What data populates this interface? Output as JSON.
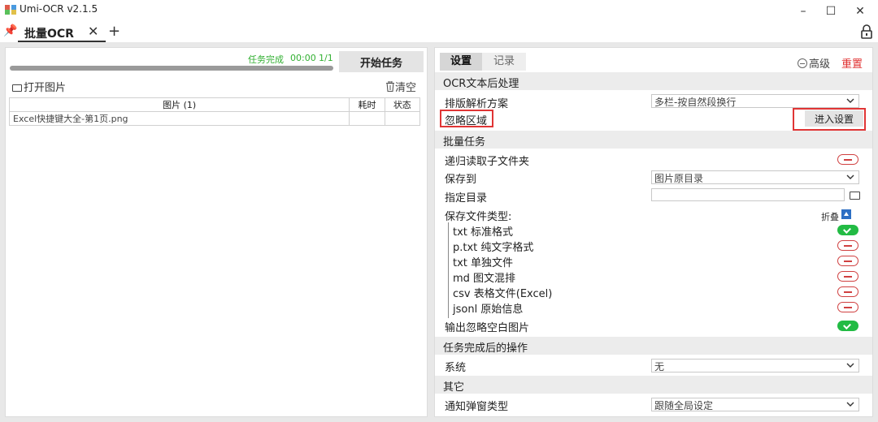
{
  "window": {
    "title": "Umi-OCR v2.1.5",
    "minimize": "–",
    "maximize": "☐",
    "close": "✕"
  },
  "tabbar": {
    "active_tab": "批量OCR",
    "close_glyph": "✕",
    "add_glyph": "+"
  },
  "left": {
    "progress_fraction": 0.999,
    "status_done": "任务完成",
    "status_time": "00:00",
    "status_count": "1/1",
    "start_button": "开始任务",
    "open_images": "打开图片",
    "clear": "清空",
    "table": {
      "columns": [
        "图片 (1)",
        "耗时",
        "状态"
      ],
      "rows": [
        [
          "Excel快捷键大全-第1页.png",
          "",
          ""
        ]
      ]
    }
  },
  "right": {
    "tabs": [
      "设置",
      "记录"
    ],
    "advanced": "高级",
    "reset": "重置",
    "sections": {
      "ocr_post": "OCR文本后处理",
      "batch": "批量任务",
      "after_done": "任务完成后的操作",
      "other": "其它"
    },
    "layout_scheme_label": "排版解析方案",
    "layout_scheme_value": "多栏-按自然段换行",
    "ignore_region_label": "忽略区域",
    "enter_settings": "进入设置",
    "recursive_label": "递归读取子文件夹",
    "save_to_label": "保存到",
    "save_to_value": "图片原目录",
    "target_dir_label": "指定目录",
    "save_types_label": "保存文件类型:",
    "fold": "折叠",
    "file_types": [
      {
        "label": "txt 标准格式",
        "on": true
      },
      {
        "label": "p.txt 纯文字格式",
        "on": false
      },
      {
        "label": "txt 单独文件",
        "on": false
      },
      {
        "label": "md 图文混排",
        "on": false
      },
      {
        "label": "csv 表格文件(Excel)",
        "on": false
      },
      {
        "label": "jsonl 原始信息",
        "on": false
      }
    ],
    "ignore_blank_label": "输出忽略空白图片",
    "system_label": "系统",
    "system_value": "无",
    "notify_label": "通知弹窗类型",
    "notify_value": "跟随全局设定"
  },
  "colors": {
    "accent_green": "#32b032",
    "toggle_on": "#22bb44",
    "toggle_off": "#d04040",
    "reset_red": "#e03030",
    "highlight_red": "#e03535"
  }
}
